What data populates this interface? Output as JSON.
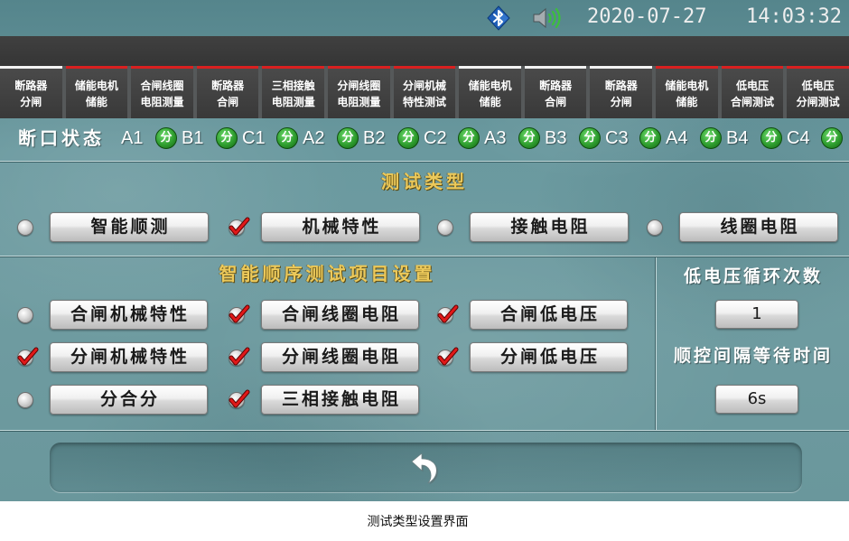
{
  "status_bar": {
    "date": "2020-07-27",
    "time": "14:03:32",
    "icons": [
      "bluetooth-icon",
      "speaker-icon"
    ]
  },
  "tabs": [
    {
      "line1": "断路器",
      "line2": "分闸",
      "accent": "#f2f2f2"
    },
    {
      "line1": "储能电机",
      "line2": "储能",
      "accent": "#d92020"
    },
    {
      "line1": "合闸线圈",
      "line2": "电阻测量",
      "accent": "#d92020"
    },
    {
      "line1": "断路器",
      "line2": "合闸",
      "accent": "#d92020"
    },
    {
      "line1": "三相接触",
      "line2": "电阻测量",
      "accent": "#d92020"
    },
    {
      "line1": "分闸线圈",
      "line2": "电阻测量",
      "accent": "#d92020"
    },
    {
      "line1": "分闸机械",
      "line2": "特性测试",
      "accent": "#d92020"
    },
    {
      "line1": "储能电机",
      "line2": "储能",
      "accent": "#f2f2f2"
    },
    {
      "line1": "断路器",
      "line2": "合闸",
      "accent": "#f2f2f2"
    },
    {
      "line1": "断路器",
      "line2": "分闸",
      "accent": "#f2f2f2"
    },
    {
      "line1": "储能电机",
      "line2": "储能",
      "accent": "#d92020"
    },
    {
      "line1": "低电压",
      "line2": "合闸测试",
      "accent": "#d92020"
    },
    {
      "line1": "低电压",
      "line2": "分闸测试",
      "accent": "#d92020"
    }
  ],
  "breaker_status": {
    "label": "断口状态",
    "state_color": "#2f9e2f",
    "items": [
      {
        "name": "A1",
        "state": "分"
      },
      {
        "name": "B1",
        "state": "分"
      },
      {
        "name": "C1",
        "state": "分"
      },
      {
        "name": "A2",
        "state": "分"
      },
      {
        "name": "B2",
        "state": "分"
      },
      {
        "name": "C2",
        "state": "分"
      },
      {
        "name": "A3",
        "state": "分"
      },
      {
        "name": "B3",
        "state": "分"
      },
      {
        "name": "C3",
        "state": "分"
      },
      {
        "name": "A4",
        "state": "分"
      },
      {
        "name": "B4",
        "state": "分"
      },
      {
        "name": "C4",
        "state": "分"
      }
    ]
  },
  "test_type": {
    "title": "测试类型",
    "options": [
      {
        "label": "智能顺测",
        "checked": false
      },
      {
        "label": "机械特性",
        "checked": true
      },
      {
        "label": "接触电阻",
        "checked": false
      },
      {
        "label": "线圈电阻",
        "checked": false
      }
    ]
  },
  "sequence_settings": {
    "title": "智能顺序测试项目设置",
    "items": [
      {
        "label": "合闸机械特性",
        "checked": false
      },
      {
        "label": "合闸线圈电阻",
        "checked": true
      },
      {
        "label": "合闸低电压",
        "checked": true
      },
      {
        "label": "分闸机械特性",
        "checked": true
      },
      {
        "label": "分闸线圈电阻",
        "checked": true
      },
      {
        "label": "分闸低电压",
        "checked": true
      },
      {
        "label": "分合分",
        "checked": false
      },
      {
        "label": "三相接触电阻",
        "checked": true
      }
    ]
  },
  "low_voltage": {
    "cycle_label": "低电压循环次数",
    "cycle_value": "1",
    "interval_label": "顺控间隔等待时间",
    "interval_value": "6s"
  },
  "footer": {
    "back_icon": "back-arrow-icon"
  },
  "caption": "测试类型设置界面",
  "colors": {
    "title_gold": "#ecc95a",
    "check_red": "#e01818",
    "background_teal": "#6a9aa0"
  }
}
